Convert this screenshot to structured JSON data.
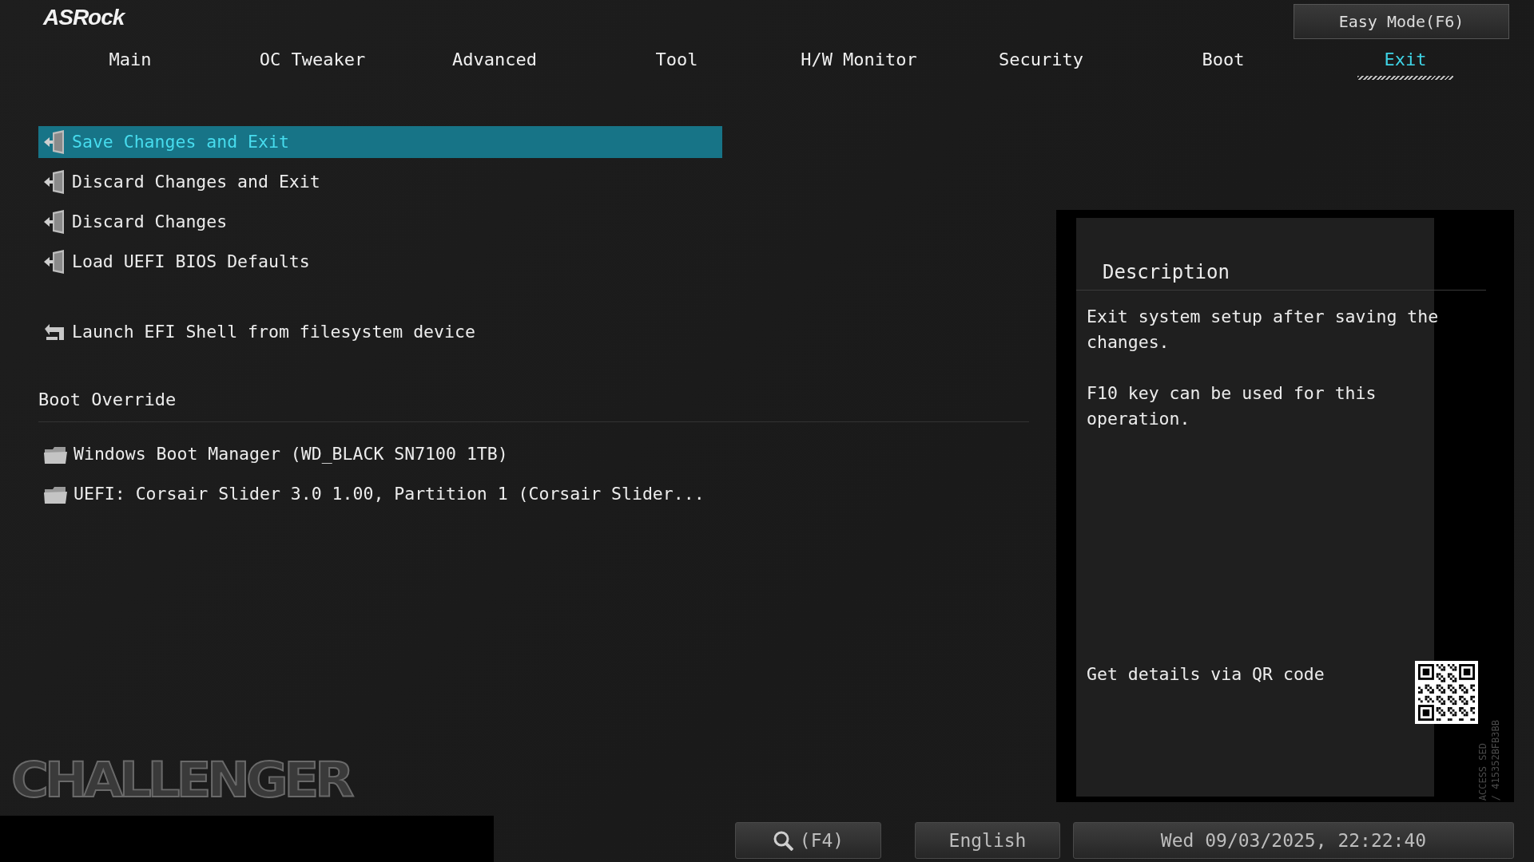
{
  "logo": "ASRock",
  "easy_mode_button": "Easy Mode(F6)",
  "tabs": [
    {
      "label": "Main",
      "selected": false
    },
    {
      "label": "OC Tweaker",
      "selected": false
    },
    {
      "label": "Advanced",
      "selected": false
    },
    {
      "label": "Tool",
      "selected": false
    },
    {
      "label": "H/W Monitor",
      "selected": false
    },
    {
      "label": "Security",
      "selected": false
    },
    {
      "label": "Boot",
      "selected": false
    },
    {
      "label": "Exit",
      "selected": true
    }
  ],
  "menu_items": [
    {
      "label": "Save Changes and Exit",
      "kind": "exit",
      "selected": true
    },
    {
      "label": "Discard Changes and Exit",
      "kind": "exit",
      "selected": false
    },
    {
      "label": "Discard Changes",
      "kind": "exit",
      "selected": false
    },
    {
      "label": "Load UEFI BIOS Defaults",
      "kind": "exit",
      "selected": false
    },
    {
      "label": "Launch EFI Shell from filesystem device",
      "kind": "shell",
      "selected": false
    }
  ],
  "boot_override": {
    "title": "Boot Override",
    "items": [
      {
        "label": "Windows Boot Manager (WD_BLACK SN7100 1TB)",
        "kind": "drive",
        "selected": false
      },
      {
        "label": "UEFI: Corsair Slider 3.0 1.00, Partition 1 (Corsair Slider...",
        "kind": "drive",
        "selected": false
      }
    ]
  },
  "description": {
    "title": "Description",
    "paragraphs": [
      "Exit system setup after saving the changes.",
      "F10 key can be used for this operation."
    ],
    "qr_caption": "Get details via QR code"
  },
  "side_code": [
    "ACCESS SED",
    "/ 415352BFB3BB"
  ],
  "brand_mark": "CHALLENGER",
  "footer": {
    "search_key": "(F4)",
    "language": "English",
    "datetime": "Wed 09/03/2025, 22:22:40"
  }
}
